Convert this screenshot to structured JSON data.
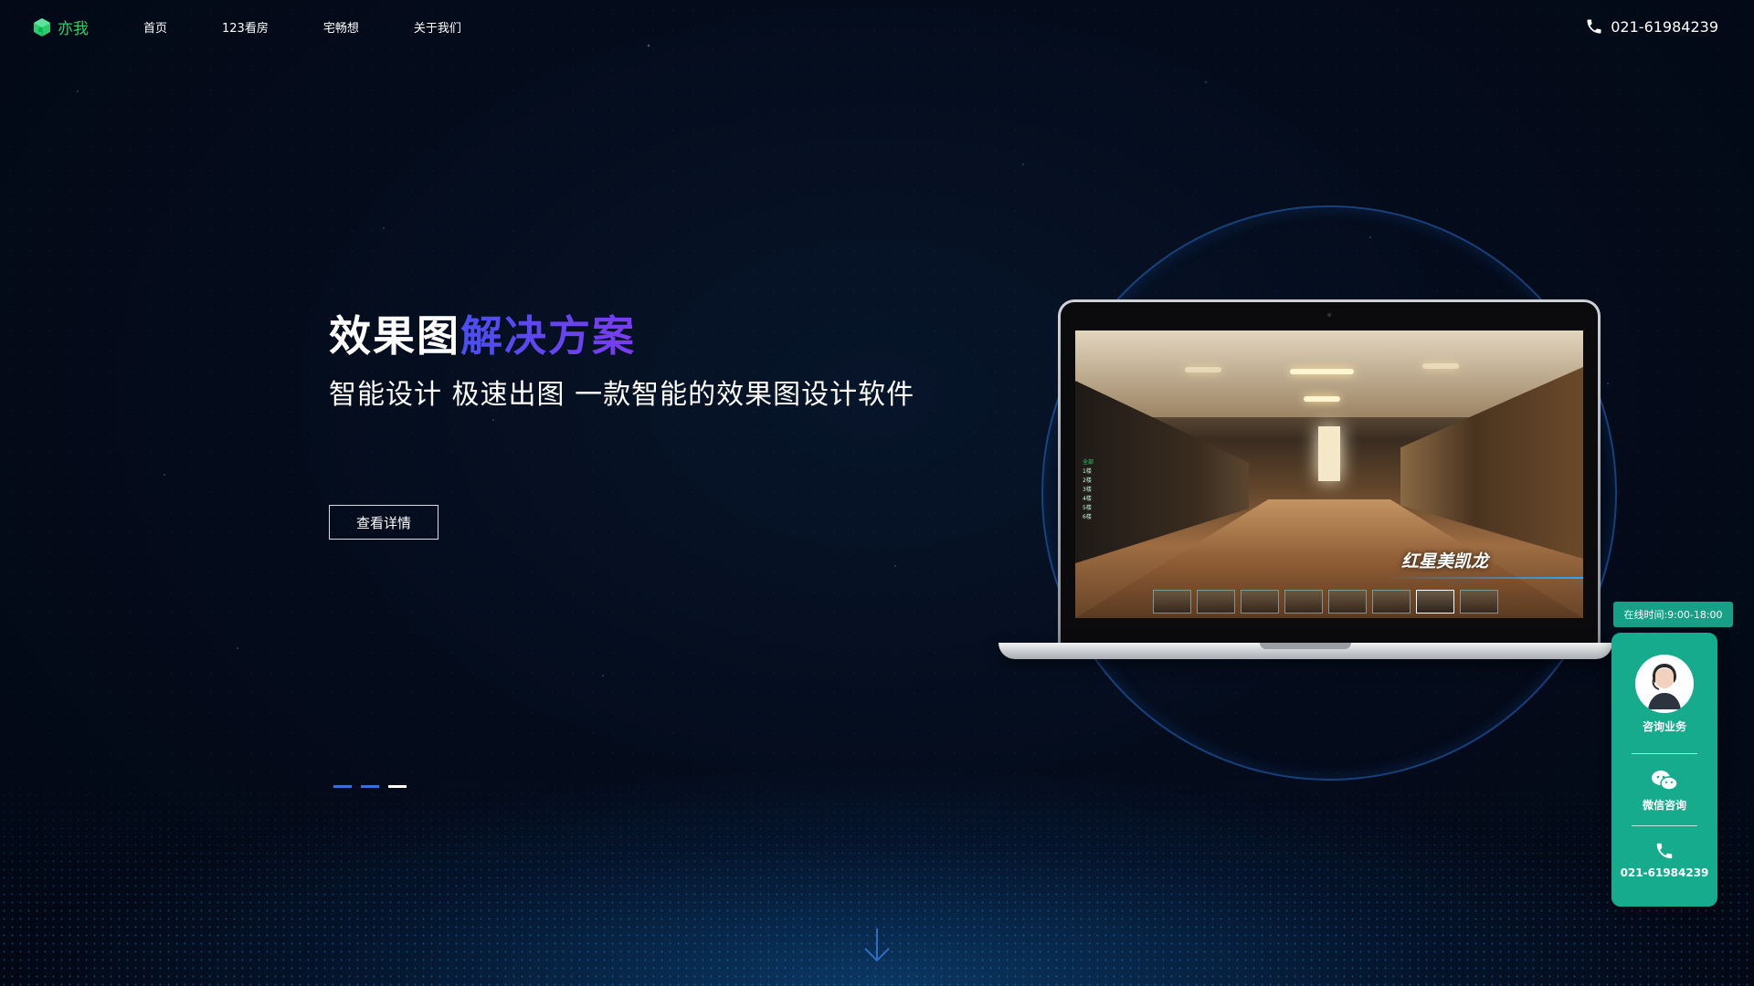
{
  "header": {
    "logo_text": "亦我",
    "nav": [
      "首页",
      "123看房",
      "宅畅想",
      "关于我们"
    ],
    "phone": "021-61984239"
  },
  "hero": {
    "title_part1": "效果图",
    "title_part2": "解决方案",
    "subtitle": "智能设计 极速出图 一款智能的效果图设计软件",
    "button": "查看详情",
    "screen_brand": "红星美凯龙",
    "floor_menu": [
      "全部",
      "1楼",
      "2楼",
      "3楼",
      "4楼",
      "5楼",
      "6楼"
    ]
  },
  "slides": {
    "count": 3,
    "active": 3
  },
  "side_panel": {
    "hours": "在线时间:9:00-18:00",
    "consult": "咨询业务",
    "wechat": "微信咨询",
    "phone": "021-61984239"
  },
  "colors": {
    "accent_green": "#17ab8e",
    "title_gradient_start": "#4a4ff0",
    "title_gradient_end": "#7a3cf0",
    "background": "#040b1a"
  },
  "icons": {
    "logo": "cube-icon",
    "header_phone": "phone-icon",
    "scroll": "arrow-down-icon",
    "wechat": "wechat-icon",
    "side_phone": "phone-icon"
  }
}
